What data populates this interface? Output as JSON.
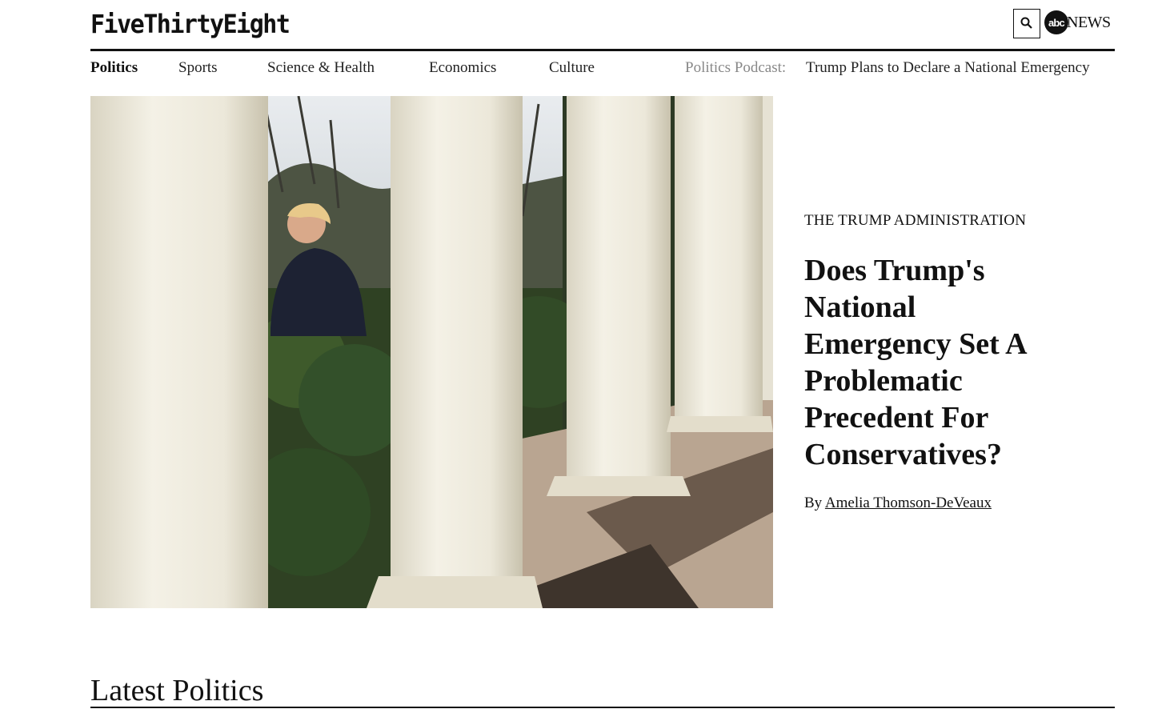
{
  "header": {
    "logo_text": "FiveThirtyEight",
    "search_icon": "search-icon",
    "partner_logo_mark": "abc",
    "partner_logo_text": "NEWS"
  },
  "nav": {
    "items": [
      {
        "label": "Politics",
        "active": true
      },
      {
        "label": "Sports",
        "active": false
      },
      {
        "label": "Science & Health",
        "active": false
      },
      {
        "label": "Economics",
        "active": false
      },
      {
        "label": "Culture",
        "active": false
      }
    ],
    "podcast_label": "Politics Podcast:",
    "podcast_title": "Trump Plans to Declare a National Emergency"
  },
  "feature": {
    "kicker": "The Trump Administration",
    "headline": "Does Trump's National Emergency Set A Problematic Precedent For Conservatives?",
    "byline_prefix": "By",
    "author": "Amelia Thomson-DeVeaux"
  },
  "section": {
    "title": "Latest Politics"
  },
  "colors": {
    "text": "#111111",
    "muted": "#888888",
    "rule": "#111111"
  }
}
